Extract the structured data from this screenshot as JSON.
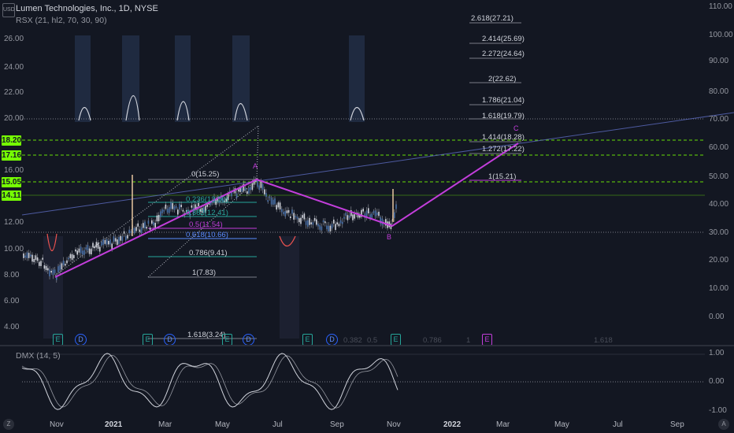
{
  "legend": {
    "title": "Lumen Technologies, Inc., 1D, NYSE",
    "rsx": "RSX (21, hl2, 70, 30, 90)",
    "dmx": "DMX (14, 5)",
    "currency": "USD"
  },
  "left_axis_labels": [
    "26.00",
    "24.00",
    "22.00",
    "20.00",
    "16.00",
    "12.00",
    "10.00",
    "8.00",
    "6.00",
    "4.00"
  ],
  "price_badges": [
    {
      "label": "18.20",
      "color": "#76ff03"
    },
    {
      "label": "17.16",
      "color": "#76ff03"
    },
    {
      "label": "15.05",
      "color": "#76ff03"
    },
    {
      "label": "14.11",
      "color": "#76ff03"
    }
  ],
  "right_axis_labels": [
    "110.00",
    "100.00",
    "90.00",
    "80.00",
    "70.00",
    "60.00",
    "50.00",
    "40.00",
    "30.00",
    "20.00",
    "10.00",
    "0.00"
  ],
  "dmx_axis_labels": [
    "1.00",
    "0.00",
    "-1.00"
  ],
  "fib_ext_labels": [
    "2.618(27.21)",
    "2.414(25.69)",
    "2.272(24.64)",
    "2(22.62)",
    "1.786(21.04)",
    "1.618(19.79)",
    "1.414(18.28)",
    "1.272(17.22)",
    "1(15.21)"
  ],
  "fib_ret_labels": [
    "0(15.25)",
    "0.236(13.50)",
    "0.382(12.41)",
    "0.5(11.54)",
    "0.618(10.66)",
    "0.786(9.41)",
    "1(7.83)",
    "1.618(3.24)"
  ],
  "wave_labels": [
    "A",
    "B",
    "C"
  ],
  "scale_labels": [
    "0.382",
    "0.5",
    "0.786",
    "1",
    "1.618"
  ],
  "event_badges": [
    "E",
    "D",
    "E",
    "D",
    "E",
    "D",
    "E",
    "D",
    "E",
    "E"
  ],
  "time_labels": [
    "Nov",
    "2021",
    "Mar",
    "May",
    "Jul",
    "Sep",
    "Nov",
    "2022",
    "Mar",
    "May",
    "Jul",
    "Sep"
  ],
  "corner_buttons": [
    "Z",
    "A"
  ],
  "colors": {
    "wave": "#c33edb",
    "fib_green": "#76ff03",
    "rsx_line": "#d1d4dc",
    "dmx_fast": "#d1d4dc",
    "dmx_slow": "#9598a1",
    "trendline": "#5c6bc0",
    "highlight": "#2a3a5a"
  }
}
